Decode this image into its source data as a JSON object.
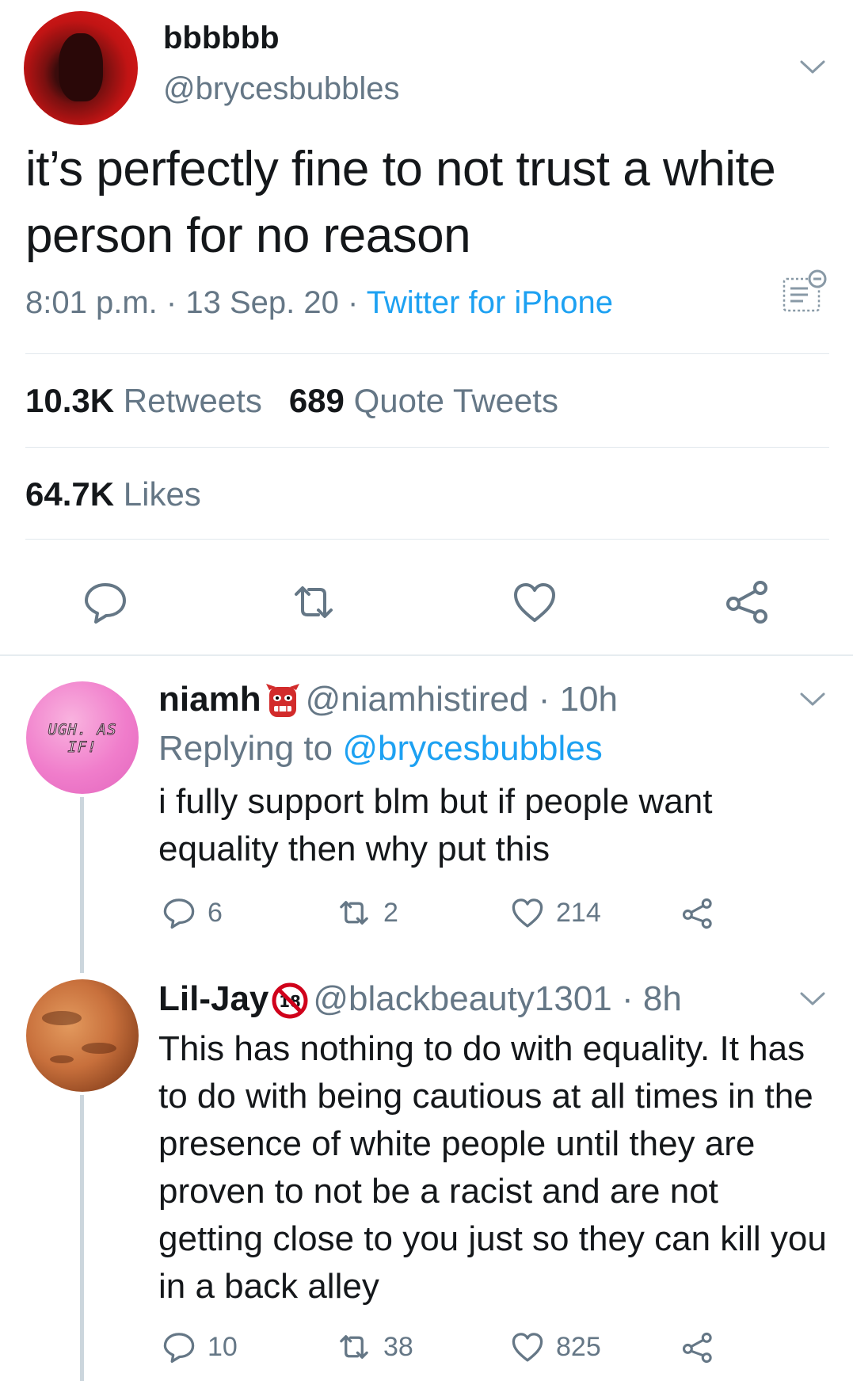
{
  "tweet": {
    "author_name": "bbbbbb",
    "author_handle": "@brycesbubbles",
    "text": "it’s perfectly fine to not trust a white person for no reason",
    "time": "8:01 p.m.",
    "date": "13 Sep. 20",
    "separator": "·",
    "source": "Twitter for iPhone",
    "retweets_count": "10.3K",
    "retweets_label": "Retweets",
    "quote_count": "689",
    "quote_label": "Quote Tweets",
    "likes_count": "64.7K",
    "likes_label": "Likes",
    "actions": [
      "reply-icon",
      "retweet-icon",
      "like-icon",
      "share-icon"
    ]
  },
  "replies": [
    {
      "author_name": "niamh",
      "author_emoji": "goblin-emoji",
      "author_handle": "@niamhistired",
      "time": "10h",
      "separator": "·",
      "avatar_text": "UGH. AS IF!",
      "replying_prefix": "Replying to",
      "replying_to": "@brycesbubbles",
      "text": "i fully support blm but if people want equality then why put this",
      "reply_count": "6",
      "retweet_count": "2",
      "like_count": "214"
    },
    {
      "author_name": "Lil-Jay",
      "author_emoji": "no-under-18-emoji",
      "author_handle": "@blackbeauty1301",
      "time": "8h",
      "separator": "·",
      "text": "This has nothing to do with equality. It has to do with being cautious at all times in the presence of white people until they are proven to not be a racist and are not getting close to you just so they can kill you in a back alley",
      "reply_count": "10",
      "retweet_count": "38",
      "like_count": "825"
    }
  ],
  "colors": {
    "text": "#14171a",
    "secondary": "#657786",
    "link": "#1da1f2",
    "divider": "#e1e8ed",
    "thread_line": "#ccd6dd"
  }
}
